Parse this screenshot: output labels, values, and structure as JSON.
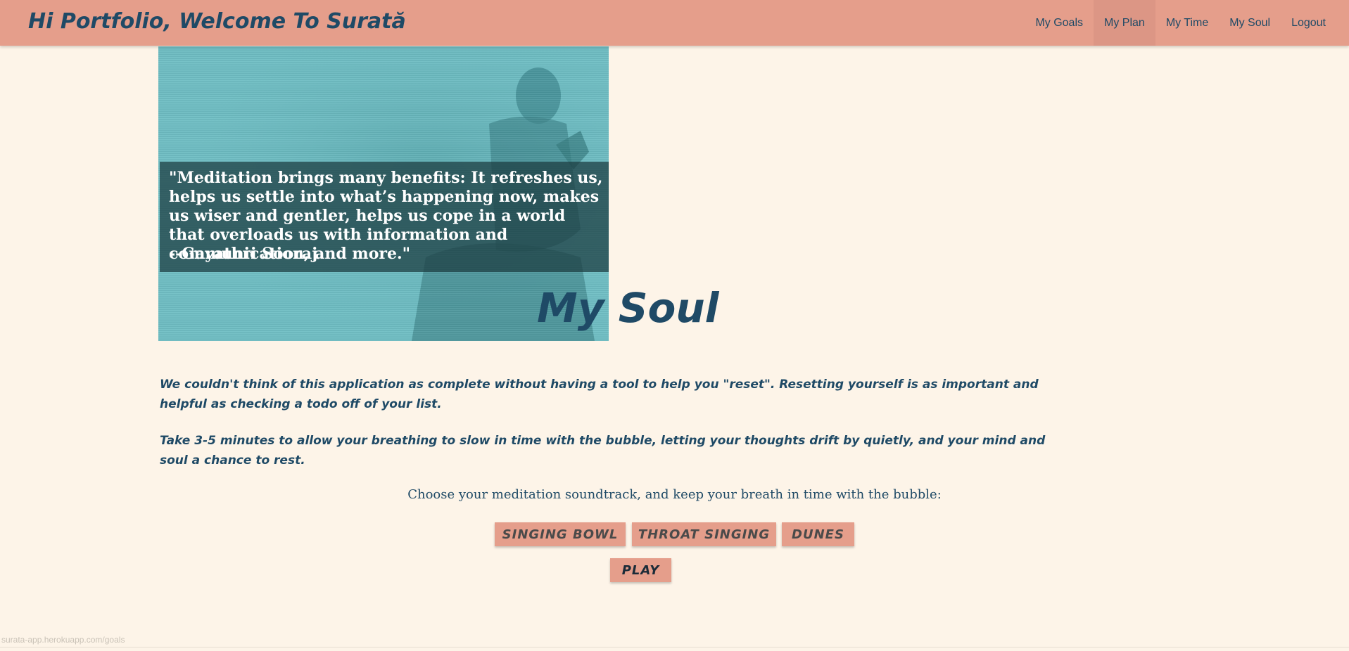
{
  "header": {
    "brand": "Hi Portfolio, Welcome To Surată",
    "nav": [
      {
        "label": "My Goals"
      },
      {
        "label": "My Plan"
      },
      {
        "label": "My Time"
      },
      {
        "label": "My Soul"
      },
      {
        "label": "Logout"
      }
    ],
    "active_item": "My Plan"
  },
  "hero": {
    "quote": "\"Meditation brings many benefits: It refreshes us, helps us settle into what’s happening now, makes us wiser and gentler, helps us cope in a world that overloads us with information and communication, and more.\"",
    "author": "--Gayathri Sooraj"
  },
  "main": {
    "title": "My Soul",
    "paragraph_1": "We couldn't think of this application as complete without having a tool to help you \"reset\". Resetting yourself is as important and helpful as checking a todo off of your list.",
    "paragraph_2": "Take 3-5 minutes to allow your breathing to slow in time with the bubble, letting your thoughts drift by quietly, and your mind and soul a chance to rest.",
    "prompt": "Choose your meditation soundtrack, and keep your breath in time with the bubble:",
    "soundtracks": [
      {
        "label": "SINGING BOWL"
      },
      {
        "label": "THROAT SINGING"
      },
      {
        "label": "DUNES"
      }
    ],
    "play_label": "PLAY"
  },
  "status_bar": {
    "url": "surata-app.herokuapp.com/goals"
  },
  "colors": {
    "navbar": "#e59e8b",
    "background": "#fdf4e8",
    "text": "#1f4a66",
    "hero": "#6fbec4",
    "button": "#e59e8b"
  },
  "icons": [
    "meditation-photo"
  ]
}
